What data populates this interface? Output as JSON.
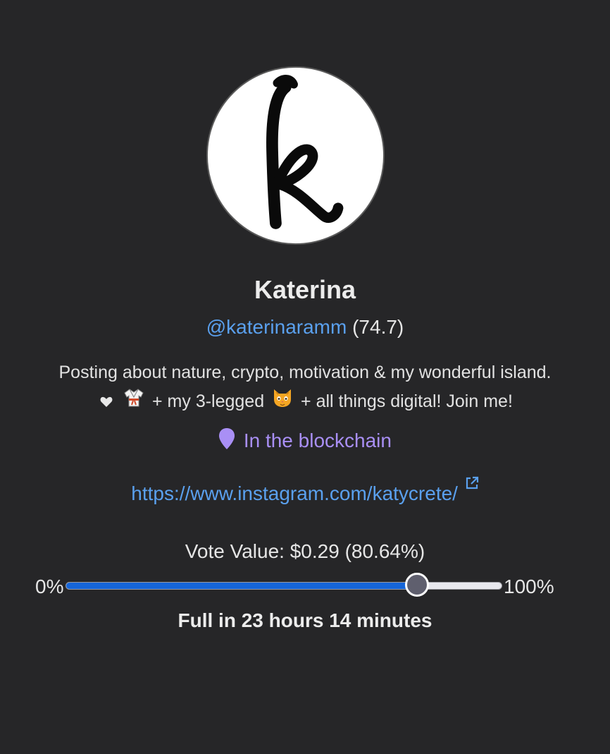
{
  "profile": {
    "display_name": "Katerina",
    "handle": "@katerinaramm",
    "reputation": "(74.7)",
    "bio_line1": "Posting about nature, crypto, motivation & my wonderful island.",
    "bio_line2_a": "+ my 3-legged",
    "bio_line2_b": "+ all things digital! Join me!",
    "location": "In the blockchain",
    "website": "https://www.instagram.com/katycrete/"
  },
  "vote": {
    "label": "Vote Value: $0.29 (80.64%)",
    "min_label": "0%",
    "max_label": "100%",
    "percent": 80.64,
    "recharge_text": "Full in 23 hours 14 minutes"
  },
  "colors": {
    "background": "#262628",
    "link": "#5aa0ee",
    "location": "#a98ff5",
    "slider_fill": "#1565d8"
  },
  "icons": {
    "avatar": "letter-k-logo",
    "heart": "white-heart-icon",
    "karate": "martial-arts-uniform-icon",
    "cat": "cat-face-icon",
    "location": "map-pin-icon",
    "external": "external-link-icon"
  }
}
